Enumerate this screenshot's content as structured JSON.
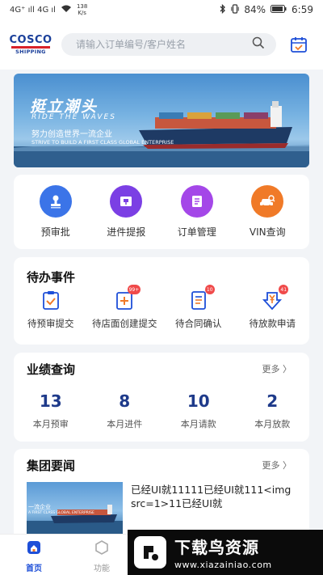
{
  "status_bar": {
    "signal_left": "4G⁺ ıll 4G ıl",
    "speed_value": "138",
    "speed_unit": "K/s",
    "battery": "84%",
    "time": "6:59"
  },
  "header": {
    "logo_top": "COSCO",
    "logo_bottom": "SHIPPING",
    "search_placeholder": "请输入订单编号/客户姓名"
  },
  "banner": {
    "title": "挺立潮头",
    "subtitle": "RIDE THE WAVES",
    "slogan": "努力创造世界一流企业",
    "slogan_en": "STRIVE TO BUILD A FIRST CLASS GLOBAL ENTERPRISE"
  },
  "quick_actions": [
    {
      "label": "预审批",
      "color": "#3b74e8",
      "icon": "stamp-icon"
    },
    {
      "label": "进件提报",
      "color": "#7b3fe4",
      "icon": "ticket-icon"
    },
    {
      "label": "订单管理",
      "color": "#a447e8",
      "icon": "document-icon"
    },
    {
      "label": "VIN查询",
      "color": "#f07a28",
      "icon": "car-search-icon"
    }
  ],
  "todo": {
    "title": "待办事件",
    "items": [
      {
        "label": "待预审提交",
        "badge": ""
      },
      {
        "label": "待店面创建提交",
        "badge": "99+"
      },
      {
        "label": "待合同确认",
        "badge": "10"
      },
      {
        "label": "待放款申请",
        "badge": "41"
      }
    ]
  },
  "performance": {
    "title": "业绩查询",
    "more": "更多 〉",
    "items": [
      {
        "value": "13",
        "label": "本月预审"
      },
      {
        "value": "8",
        "label": "本月进件"
      },
      {
        "value": "10",
        "label": "本月请款"
      },
      {
        "value": "2",
        "label": "本月放款"
      }
    ]
  },
  "news": {
    "title": "集团要闻",
    "more": "更多 〉",
    "item_text": "已经UI就11111已经UI就111<img src=1>11已经UI就",
    "thumb_caption": "一流企业",
    "thumb_caption_en": "A FIRST CLASS GLOBAL ENTERPRISE"
  },
  "tabbar": {
    "home": "首页",
    "function": "功能"
  },
  "watermark": {
    "title": "下载鸟资源",
    "url": "www.xiazainiao.com"
  },
  "colors": {
    "accent": "#1e4fd8",
    "number": "#1e3a8a",
    "badge": "#f04a4a"
  }
}
